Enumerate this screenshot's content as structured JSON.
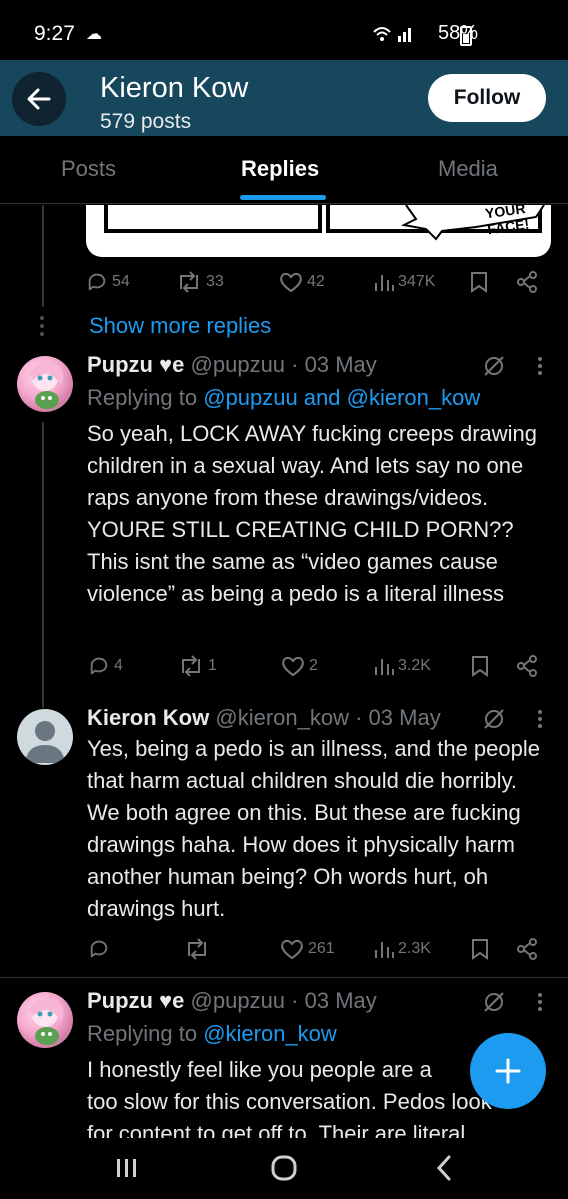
{
  "status_bar": {
    "time": "9:27",
    "battery": "58%"
  },
  "header": {
    "name": "Kieron Kow",
    "post_count": "579 posts",
    "follow_label": "Follow"
  },
  "tabs": [
    {
      "label": "Posts"
    },
    {
      "label": "Replies"
    },
    {
      "label": "Media"
    }
  ],
  "comic_partial_text": "YOUR FACE!",
  "tweet0_actions": {
    "replies": "54",
    "reposts": "33",
    "likes": "42",
    "views": "347K"
  },
  "show_more_replies": "Show more replies",
  "tweets": [
    {
      "display_name": "Pupzu ♥e",
      "handle": "@pupzuu",
      "date": "· 03 May",
      "replying_prefix": "Replying to ",
      "replying_mentions": "@pupzuu and @kieron_kow",
      "body": "So yeah, LOCK AWAY fucking creeps drawing children in a sexual way. And lets say no one raps anyone from these drawings/videos. YOURE STILL CREATING CHILD PORN?? This isnt the same as “video games cause violence” as being a pedo is a literal illness",
      "replies": "4",
      "reposts": "1",
      "likes": "2",
      "views": "3.2K"
    },
    {
      "display_name": "Kieron Kow",
      "handle": "@kieron_kow",
      "date": "· 03 May",
      "body": "Yes, being a pedo is an illness, and the people that harm actual children should die horribly. We both agree on this. But these are fucking drawings haha. How does it physically harm another human being? Oh words hurt, oh drawings hurt.",
      "replies": "",
      "reposts": "",
      "likes": "261",
      "views": "2.3K"
    },
    {
      "display_name": "Pupzu ♥e",
      "handle": "@pupzuu",
      "date": "· 03 May",
      "replying_prefix": "Replying to ",
      "replying_mentions": "@kieron_kow",
      "body_line1": "I honestly feel like you people are a",
      "body_line2": "too slow for this conversation. Pedos look",
      "body_line3": "for content to get off to. Their are literal"
    }
  ],
  "colors": {
    "accent": "#1d9bf0",
    "header_bg": "#17475d",
    "muted": "#71767b"
  }
}
